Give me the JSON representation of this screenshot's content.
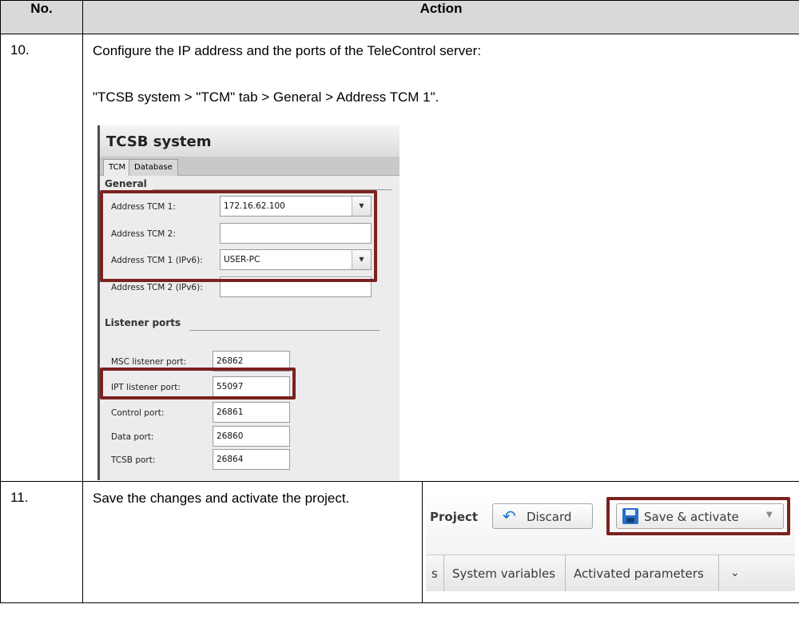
{
  "table": {
    "headers": [
      "No.",
      "Action"
    ],
    "rows": [
      {
        "number": "10.",
        "text_line1": "Configure the IP address and the ports of the TeleControl server:",
        "text_line2": "\"TCSB system > \"TCM\" tab > General > Address TCM 1\"."
      },
      {
        "number": "11.",
        "text": "Save the changes and activate the project."
      }
    ]
  },
  "tcsb_screenshot": {
    "title": "TCSB system",
    "tabs": [
      "TCM",
      "Database"
    ],
    "active_tab": "TCM",
    "general": {
      "section_title": "General",
      "fields": [
        {
          "label": "Address TCM 1:",
          "value": "172.16.62.100",
          "dropdown": true
        },
        {
          "label": "Address TCM 2:",
          "value": "",
          "dropdown": false
        },
        {
          "label": "Address TCM 1 (IPv6):",
          "value": "USER-PC",
          "dropdown": true
        },
        {
          "label": "Address TCM 2 (IPv6):",
          "value": "",
          "dropdown": false
        }
      ]
    },
    "listener_ports": {
      "section_title": "Listener ports",
      "fields": [
        {
          "label": "MSC listener port:",
          "value": "26862"
        },
        {
          "label": "IPT listener port:",
          "value": "55097"
        },
        {
          "label": "Control port:",
          "value": "26861"
        },
        {
          "label": "Data port:",
          "value": "26860"
        },
        {
          "label": "TCSB port:",
          "value": "26864"
        }
      ]
    },
    "highlight_color": "#7a2220"
  },
  "toolbar_screenshot": {
    "project_label": "Project",
    "discard_label": "Discard",
    "save_label": "Save & activate",
    "tabs": [
      "s",
      "System variables",
      "Activated parameters"
    ],
    "icons": [
      "undo-icon",
      "save-icon",
      "chevron-down-icon"
    ]
  }
}
